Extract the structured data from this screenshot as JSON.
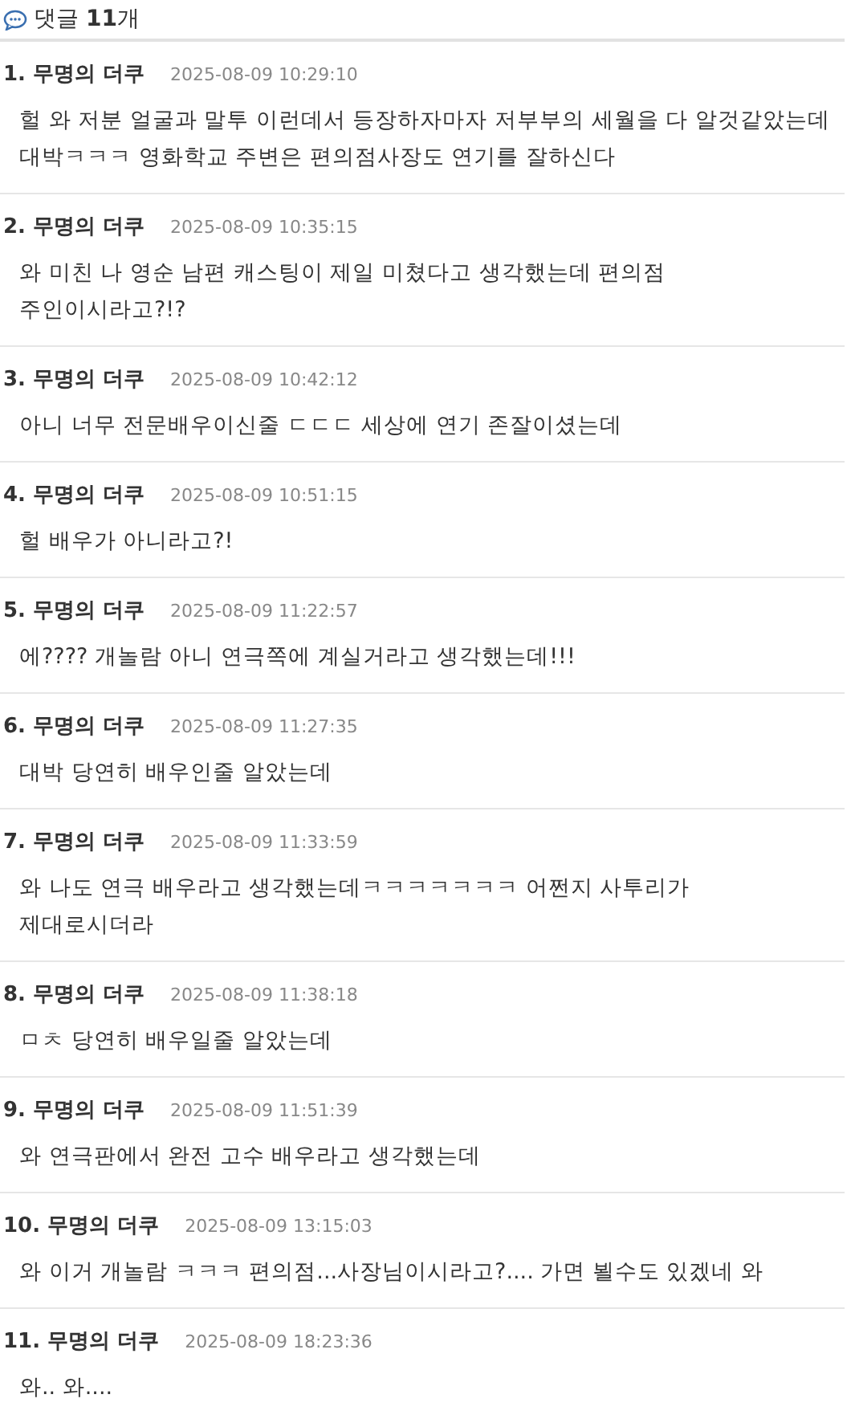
{
  "header": {
    "title": "댓글 **11**개"
  },
  "comments": [
    {
      "author": "1. 무명의 더쿠",
      "time": "2025-08-09 10:29:10",
      "text": "헐 와 저분 얼굴과 말투 이런데서 등장하자마자 저부부의 세월을 다 알것같았는데 대박ㅋㅋㅋ 영화학교 주변은 편의점사장도 연기를 잘하신다"
    },
    {
      "author": "2. 무명의 더쿠",
      "time": "2025-08-09 10:35:15",
      "text": "와 미친 나 영순 남편 캐스팅이 제일 미쳤다고 생각했는데 편의점 주인이시라고?!?"
    },
    {
      "author": "3. 무명의 더쿠",
      "time": "2025-08-09 10:42:12",
      "text": "아니 너무 전문배우이신줄 ㄷㄷㄷ 세상에 연기 존잘이셨는데"
    },
    {
      "author": "4. 무명의 더쿠",
      "time": "2025-08-09 10:51:15",
      "text": "헐 배우가 아니라고?!"
    },
    {
      "author": "5. 무명의 더쿠",
      "time": "2025-08-09 11:22:57",
      "text": "에???? 개놀람 아니 연극쪽에 계실거라고 생각했는데!!!"
    },
    {
      "author": "6. 무명의 더쿠",
      "time": "2025-08-09 11:27:35",
      "text": "대박 당연히 배우인줄 알았는데"
    },
    {
      "author": "7. 무명의 더쿠",
      "time": "2025-08-09 11:33:59",
      "text": "와 나도 연극 배우라고 생각했는데ㅋㅋㅋㅋㅋㅋㅋ 어쩐지 사투리가 제대로시더라"
    },
    {
      "author": "8. 무명의 더쿠",
      "time": "2025-08-09 11:38:18",
      "text": "ㅁㅊ 당연히 배우일줄 알았는데"
    },
    {
      "author": "9. 무명의 더쿠",
      "time": "2025-08-09 11:51:39",
      "text": "와 연극판에서 완전 고수 배우라고 생각했는데"
    },
    {
      "author": "10. 무명의 더쿠",
      "time": "2025-08-09 13:15:03",
      "text": "와 이거 개놀람 ㅋㅋㅋ 편의점...사장님이시라고?.... 가면 뵐수도 있겠네 와"
    },
    {
      "author": "11. 무명의 더쿠",
      "time": "2025-08-09 18:23:36",
      "text": "와.. 와...."
    }
  ]
}
